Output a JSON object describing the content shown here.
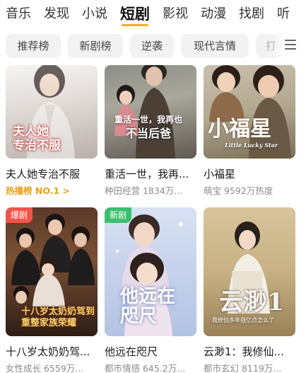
{
  "top_tabs": [
    {
      "label": "音乐",
      "active": false
    },
    {
      "label": "发现",
      "active": false
    },
    {
      "label": "小说",
      "active": false
    },
    {
      "label": "短剧",
      "active": true
    },
    {
      "label": "影视",
      "active": false
    },
    {
      "label": "动漫",
      "active": false
    },
    {
      "label": "找剧",
      "active": false
    },
    {
      "label": "听",
      "active": false
    }
  ],
  "sub_tabs": [
    "推荐榜",
    "新剧榜",
    "逆袭",
    "现代言情",
    "打"
  ],
  "icons": {
    "menu": "menu-list-icon"
  },
  "colors": {
    "accent": "#f0b21a",
    "hot_badge": "#f2544a",
    "new_badge": "#3bbf6f",
    "hot_rank": "#e7a017"
  },
  "cards": [
    {
      "title": "夫人她专治不服",
      "meta": "热播榜 NO.1 >",
      "meta_hot": true,
      "badge": "",
      "cover_text": "夫人她专治不服"
    },
    {
      "title": "重活一世，我再...",
      "meta": "种田经营 1834万...",
      "meta_hot": false,
      "badge": "",
      "cover_text": "重活一世，我再也不当后爸"
    },
    {
      "title": "小福星",
      "meta": "萌宝 9592万热度",
      "meta_hot": false,
      "badge": "",
      "cover_text": "小福星"
    },
    {
      "title": "十八岁太奶奶驾...",
      "meta": "女性成长 6559万...",
      "meta_hot": false,
      "badge": "爆剧",
      "cover_text": "十八岁太奶奶驾到 重整家族荣耀"
    },
    {
      "title": "他远在咫尺",
      "meta": "都市情感 645.2万...",
      "meta_hot": false,
      "badge": "新剧",
      "cover_text": "他远在咫尺"
    },
    {
      "title": "云渺1：我修仙...",
      "meta": "都市玄幻 8119万...",
      "meta_hot": false,
      "badge": "",
      "cover_text": "云渺1"
    }
  ]
}
